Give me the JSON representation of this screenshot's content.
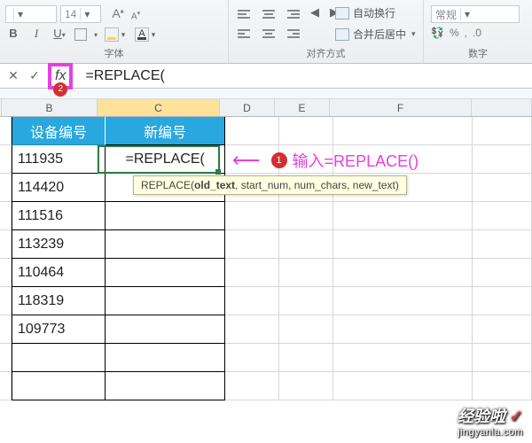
{
  "ribbon": {
    "font_size_value": "14",
    "group_font": "字体",
    "group_align": "对齐方式",
    "group_number": "数字",
    "wrap_text": "自动换行",
    "merge_center": "合并后居中",
    "number_format": "常规"
  },
  "formula_bar": {
    "cancel": "✕",
    "confirm": "✓",
    "fx": "fx",
    "value": "=REPLACE(",
    "badge": "2"
  },
  "columns": [
    "B",
    "C",
    "D",
    "E",
    "F"
  ],
  "headers": {
    "b": "设备编号",
    "c": "新编号"
  },
  "active_cell_value": "=REPLACE(",
  "data_rows": [
    "111935",
    "114420",
    "111516",
    "113239",
    "110464",
    "118319",
    "109773"
  ],
  "tooltip": {
    "fn": "REPLACE",
    "args": [
      "old_text",
      "start_num",
      "num_chars",
      "new_text"
    ],
    "bold_arg_index": 0
  },
  "annotation": {
    "num": "1",
    "text": "输入=REPLACE()"
  },
  "watermark": {
    "main": "经验啦",
    "check": "✓",
    "sub": "jingyanla.com"
  },
  "chart_data": null
}
